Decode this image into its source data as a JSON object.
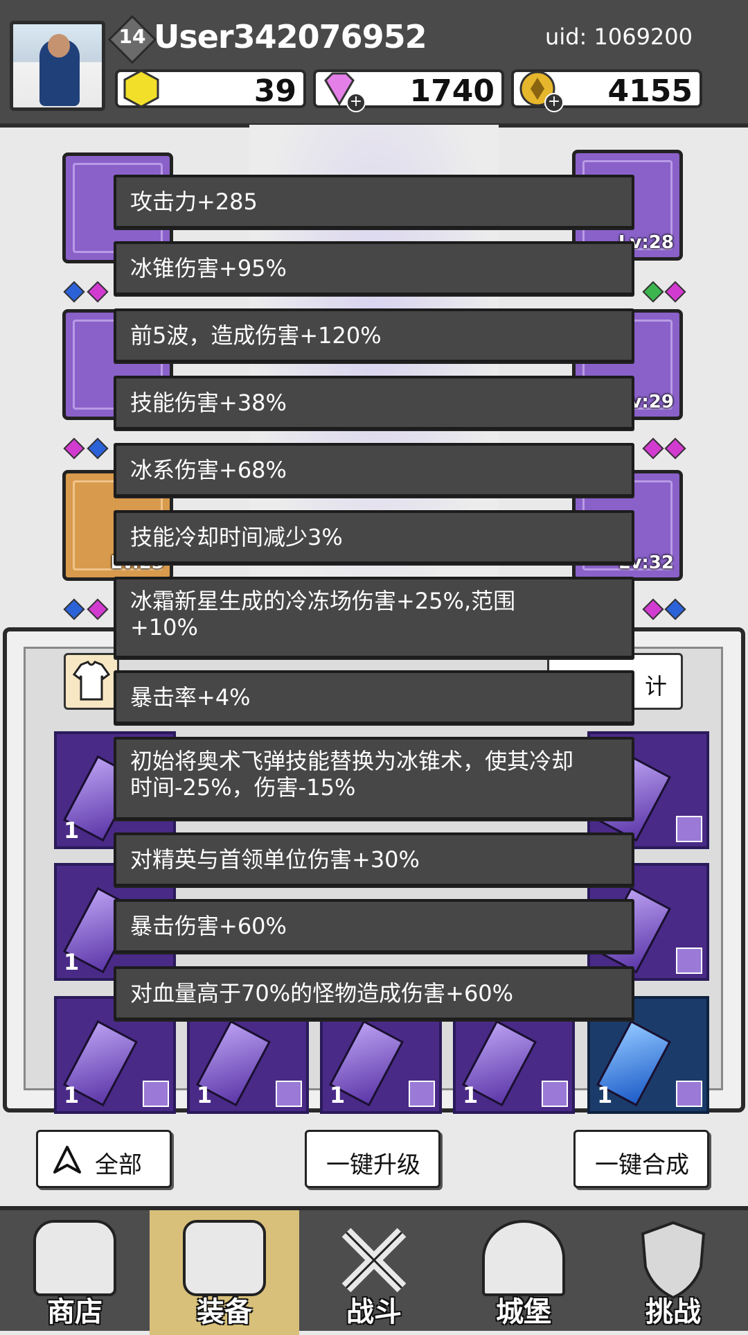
{
  "player": {
    "level": "14",
    "username": "User342076952",
    "uid": "uid: 1069200"
  },
  "resources": {
    "energy": "39",
    "gems": "1740",
    "coins": "4155"
  },
  "equipment": {
    "right_levels": [
      "Lv:28",
      "Lv:29",
      "Lv:32"
    ],
    "left_level_partial": "Lv.23"
  },
  "inventory": {
    "stats_button_partial": "计",
    "counts": [
      "1",
      "1",
      "1",
      "1",
      "1",
      "1",
      "1",
      "1"
    ]
  },
  "tooltip": {
    "lines": [
      "攻击力+285",
      "冰锥伤害+95%",
      "前5波，造成伤害+120%",
      "技能伤害+38%",
      "冰系伤害+68%",
      "技能冷却时间减少3%",
      "冰霜新星生成的冷冻场伤害+25%,范围+10%",
      "暴击率+4%",
      "初始将奥术飞弹技能替换为冰锥术，使其冷却时间-25%，伤害-15%",
      "对精英与首领单位伤害+30%",
      "暴击伤害+60%",
      "对血量高于70%的怪物造成伤害+60%"
    ]
  },
  "actions": {
    "all": "全部",
    "upgrade_all": "一键升级",
    "merge_all": "一键合成"
  },
  "nav": [
    "商店",
    "装备",
    "战斗",
    "城堡",
    "挑战"
  ]
}
